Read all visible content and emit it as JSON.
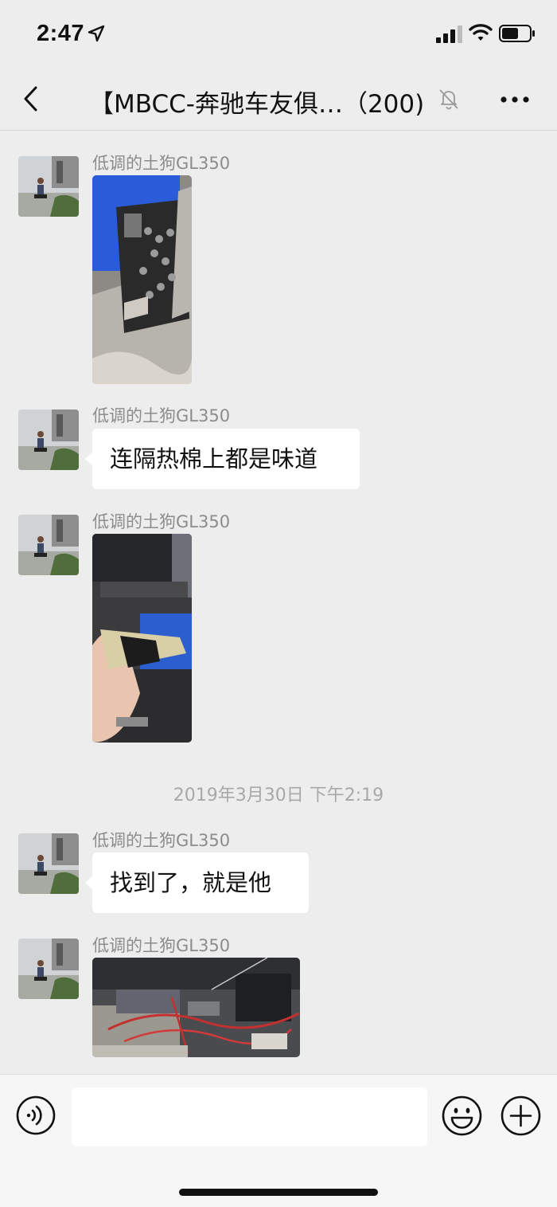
{
  "status_bar": {
    "time": "2:47",
    "icons": [
      "location-arrow-icon",
      "cellular-signal-icon",
      "wifi-icon",
      "battery-icon"
    ]
  },
  "nav": {
    "title": "【MBCC-奔驰车友俱…（200)",
    "icons": [
      "back-chevron-icon",
      "muted-bell-icon",
      "more-dots-icon"
    ]
  },
  "messages": [
    {
      "sender": "低调的土狗GL350",
      "type": "image",
      "image_desc": ""
    },
    {
      "sender": "低调的土狗GL350",
      "type": "text",
      "text": "连隔热棉上都是味道"
    },
    {
      "sender": "低调的土狗GL350",
      "type": "image",
      "image_desc": ""
    },
    {
      "sender": "低调的土狗GL350",
      "type": "text",
      "text": "找到了，就是他"
    },
    {
      "sender": "低调的土狗GL350",
      "type": "image",
      "image_desc": ""
    }
  ],
  "timestamp": "2019年3月30日 下午2:19",
  "input_bar": {
    "placeholder": "",
    "icons": [
      "voice-icon",
      "emoji-icon",
      "plus-icon"
    ]
  },
  "colors": {
    "background": "#ededed",
    "bubble": "#ffffff",
    "sender_text": "#8c8c8c",
    "timestamp_text": "#a8a8a8"
  }
}
